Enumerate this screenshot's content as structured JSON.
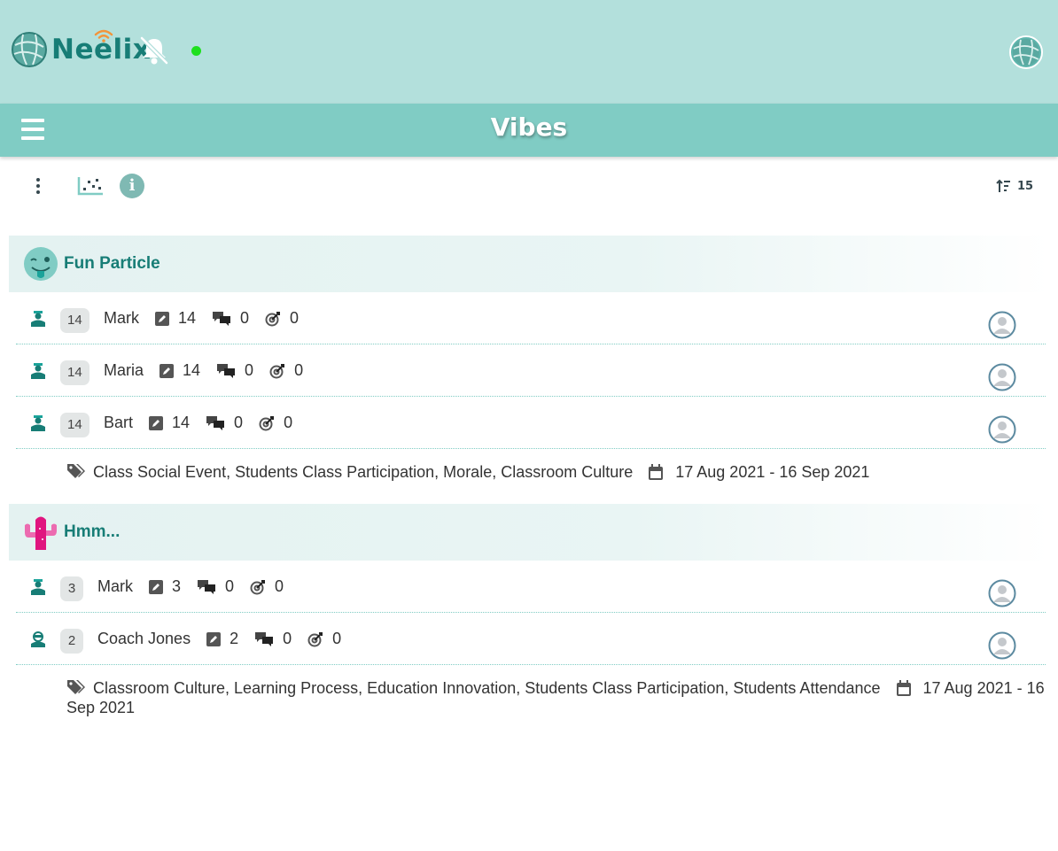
{
  "app": {
    "logo_text": "Neelix",
    "online_status_color": "#1ee01e",
    "brand_color": "#177d76",
    "header_color": "#b3e0dc",
    "titlebar_color": "#80ccc4"
  },
  "page": {
    "title": "Vibes"
  },
  "toolbar": {
    "icons": [
      "more-vertical-icon",
      "scatter-chart-icon",
      "info-icon",
      "sort-icon"
    ],
    "sort_count": "15"
  },
  "groups": [
    {
      "title": "Fun Particle",
      "emoji": "winking-tongue-face-icon",
      "rows": [
        {
          "role": "teacher",
          "badge": "14",
          "name": "Mark",
          "posts": "14",
          "comments": "0",
          "reactions": "0"
        },
        {
          "role": "teacher",
          "badge": "14",
          "name": "Maria",
          "posts": "14",
          "comments": "0",
          "reactions": "0"
        },
        {
          "role": "teacher",
          "badge": "14",
          "name": "Bart",
          "posts": "14",
          "comments": "0",
          "reactions": "0"
        }
      ],
      "tags": "Class Social Event, Students Class Participation, Morale, Classroom Culture",
      "date_range": "17 Aug 2021 - 16 Sep 2021"
    },
    {
      "title": "Hmm...",
      "emoji": "cactus-icon",
      "rows": [
        {
          "role": "teacher",
          "badge": "3",
          "name": "Mark",
          "posts": "3",
          "comments": "0",
          "reactions": "0"
        },
        {
          "role": "coach",
          "badge": "2",
          "name": "Coach Jones",
          "posts": "2",
          "comments": "0",
          "reactions": "0"
        }
      ],
      "tags": "Classroom Culture, Learning Process, Education Innovation, Students Class Participation, Students Attendance",
      "date_range": "17 Aug 2021 - 16 Sep 2021"
    }
  ]
}
